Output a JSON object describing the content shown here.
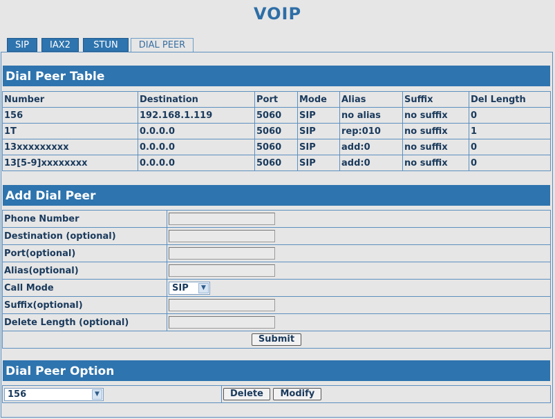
{
  "page": {
    "title": "VOIP"
  },
  "tabs": [
    {
      "label": "SIP",
      "active": false
    },
    {
      "label": "IAX2",
      "active": false
    },
    {
      "label": "STUN",
      "active": false
    },
    {
      "label": "DIAL PEER",
      "active": true
    }
  ],
  "dial_peer_table": {
    "title": "Dial Peer Table",
    "columns": [
      "Number",
      "Destination",
      "Port",
      "Mode",
      "Alias",
      "Suffix",
      "Del Length"
    ],
    "rows": [
      [
        "156",
        "192.168.1.119",
        "5060",
        "SIP",
        "no alias",
        "no suffix",
        "0"
      ],
      [
        "1T",
        "0.0.0.0",
        "5060",
        "SIP",
        "rep:010",
        "no suffix",
        "1"
      ],
      [
        "13xxxxxxxxx",
        "0.0.0.0",
        "5060",
        "SIP",
        "add:0",
        "no suffix",
        "0"
      ],
      [
        "13[5-9]xxxxxxxx",
        "0.0.0.0",
        "5060",
        "SIP",
        "add:0",
        "no suffix",
        "0"
      ]
    ]
  },
  "add_dial_peer": {
    "title": "Add Dial Peer",
    "fields": {
      "phone_number": {
        "label": "Phone Number",
        "value": ""
      },
      "destination": {
        "label": "Destination (optional)",
        "value": ""
      },
      "port": {
        "label": "Port(optional)",
        "value": ""
      },
      "alias": {
        "label": "Alias(optional)",
        "value": ""
      },
      "call_mode": {
        "label": "Call Mode",
        "value": "SIP"
      },
      "suffix": {
        "label": "Suffix(optional)",
        "value": ""
      },
      "delete_length": {
        "label": "Delete Length (optional)",
        "value": ""
      }
    },
    "submit_label": "Submit"
  },
  "dial_peer_option": {
    "title": "Dial Peer Option",
    "selected": "156",
    "delete_label": "Delete",
    "modify_label": "Modify"
  },
  "colors": {
    "accent": "#2e74ae",
    "title": "#2e6ea6",
    "text": "#1a3a5c",
    "background": "#e6e6e6"
  }
}
